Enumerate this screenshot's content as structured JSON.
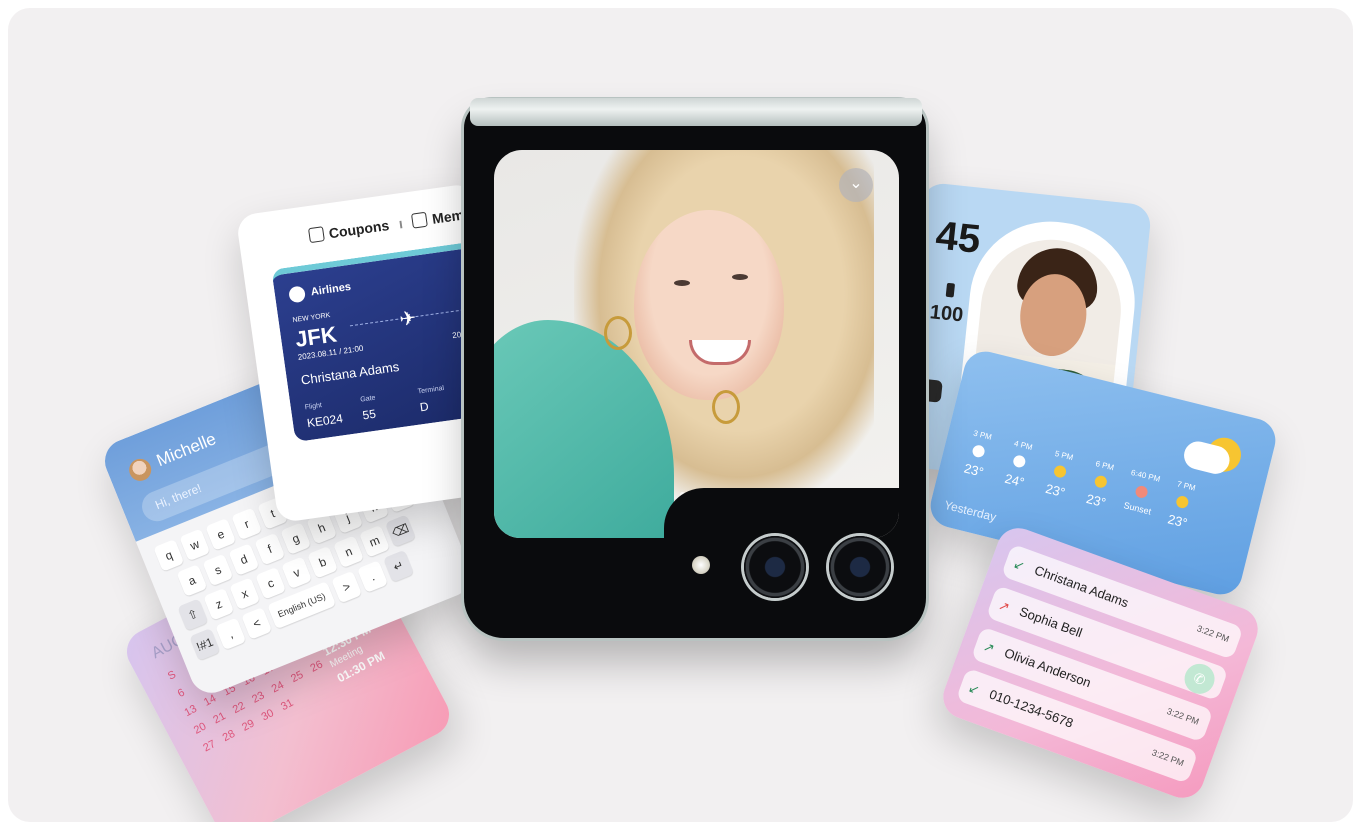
{
  "calendar": {
    "month": "AUG",
    "days": [
      "S",
      "M",
      "T",
      "W",
      "T",
      "F",
      "S",
      "6",
      "7",
      "8",
      "9",
      "10",
      "11",
      "12",
      "13",
      "14",
      "15",
      "16",
      "17",
      "18",
      "19",
      "20",
      "21",
      "22",
      "23",
      "24",
      "25",
      "26",
      "27",
      "28",
      "29",
      "30",
      "31",
      "",
      ""
    ],
    "events": [
      {
        "time": "12:30 PM",
        "label": "Shopping"
      },
      {
        "time": "12:30 PM",
        "label": "UX design meeting"
      },
      {
        "time": "12:30 PM",
        "label": "Meeting"
      },
      {
        "time": "01:30 PM",
        "label": ""
      }
    ]
  },
  "chat": {
    "name": "Michelle",
    "message": "Hi, there!",
    "keyboard": {
      "row1": [
        "q",
        "w",
        "e",
        "r",
        "t",
        "y",
        "u",
        "i",
        "o",
        "p"
      ],
      "row2": [
        "a",
        "s",
        "d",
        "f",
        "g",
        "h",
        "j",
        "k",
        "l"
      ],
      "row3": [
        "⇧",
        "z",
        "x",
        "c",
        "v",
        "b",
        "n",
        "m",
        "⌫"
      ],
      "row4": [
        "!#1",
        ",",
        "<",
        "English (US)",
        ">",
        ".",
        "↵"
      ]
    }
  },
  "coupons": {
    "tab1": "Coupons",
    "tab2": "Mem",
    "ticket": {
      "airline": "Airlines",
      "city": "NEW YORK",
      "code": "JFK",
      "date": "2023.08.11 / 21:00",
      "date_right": "202",
      "passenger": "Christana Adams",
      "flight_label": "Flight",
      "flight": "KE024",
      "gate_label": "Gate",
      "gate": "55",
      "terminal_label": "Terminal",
      "terminal": "D"
    }
  },
  "phone": {
    "chevron": "⌄"
  },
  "portrait": {
    "clock": "45",
    "battery": "100"
  },
  "weather": {
    "hours": [
      {
        "h": "3 PM",
        "t": "23°",
        "icon": "cloud",
        "color": "#ffffff"
      },
      {
        "h": "4 PM",
        "t": "24°",
        "icon": "cloud",
        "color": "#ffffff"
      },
      {
        "h": "5 PM",
        "t": "23°",
        "icon": "sun",
        "color": "#f7c531"
      },
      {
        "h": "6 PM",
        "t": "23°",
        "icon": "sun",
        "color": "#f7c531"
      },
      {
        "h": "6:40 PM",
        "t": "Sunset",
        "icon": "sunset",
        "color": "#f08a7a"
      },
      {
        "h": "7 PM",
        "t": "23°",
        "icon": "moon",
        "color": "#f7c531"
      }
    ],
    "yesterday": "Yesterday"
  },
  "calls": {
    "rows": [
      {
        "name": "Christana Adams",
        "time": "3:22 PM",
        "icon": "incoming",
        "color": "#2c8c5a"
      },
      {
        "name": "Sophia Bell",
        "time": "",
        "icon": "missed",
        "color": "#e14b4b"
      },
      {
        "name": "Olivia Anderson",
        "time": "3:22 PM",
        "icon": "outgoing",
        "color": "#2c8c5a"
      },
      {
        "name": "010-1234-5678",
        "time": "3:22 PM",
        "icon": "incoming",
        "color": "#2c8c5a"
      }
    ]
  }
}
